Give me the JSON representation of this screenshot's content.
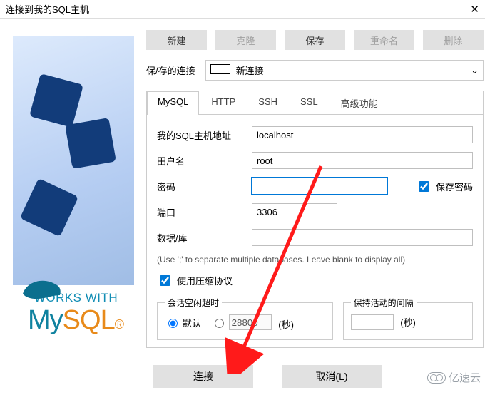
{
  "window": {
    "title": "连接到我的SQL主机"
  },
  "toolbar": {
    "new": "新建",
    "clone": "克隆",
    "save": "保存",
    "rename": "重命名",
    "delete": "删除"
  },
  "saved": {
    "label": "保/存的连接",
    "selected": "新连接"
  },
  "tabs": {
    "mysql": "MySQL",
    "http": "HTTP",
    "ssh": "SSH",
    "ssl": "SSL",
    "advanced": "高级功能"
  },
  "form": {
    "host_label": "我的SQL主机地址",
    "host_value": "localhost",
    "user_label": "田户名",
    "user_value": "root",
    "pass_label": "密码",
    "pass_value": "",
    "savepass_label": "保存密码",
    "port_label": "端口",
    "port_value": "3306",
    "db_label": "数据/库",
    "db_value": "",
    "db_hint": "(Use ';' to separate multiple databases. Leave blank to display all)",
    "compress_label": "使用压缩协议"
  },
  "timeout": {
    "idle_legend": "会话空闲超时",
    "idle_default": "默认",
    "idle_custom": "28800",
    "idle_unit": "(秒)",
    "keepalive_legend": "保持活动的间隔",
    "keepalive_unit": "(秒)"
  },
  "footer": {
    "connect": "连接",
    "cancel": "取消(L)"
  },
  "branding": {
    "works_with": "WORKS WITH",
    "my": "My",
    "sql": "SQL"
  },
  "watermark": "亿速云"
}
